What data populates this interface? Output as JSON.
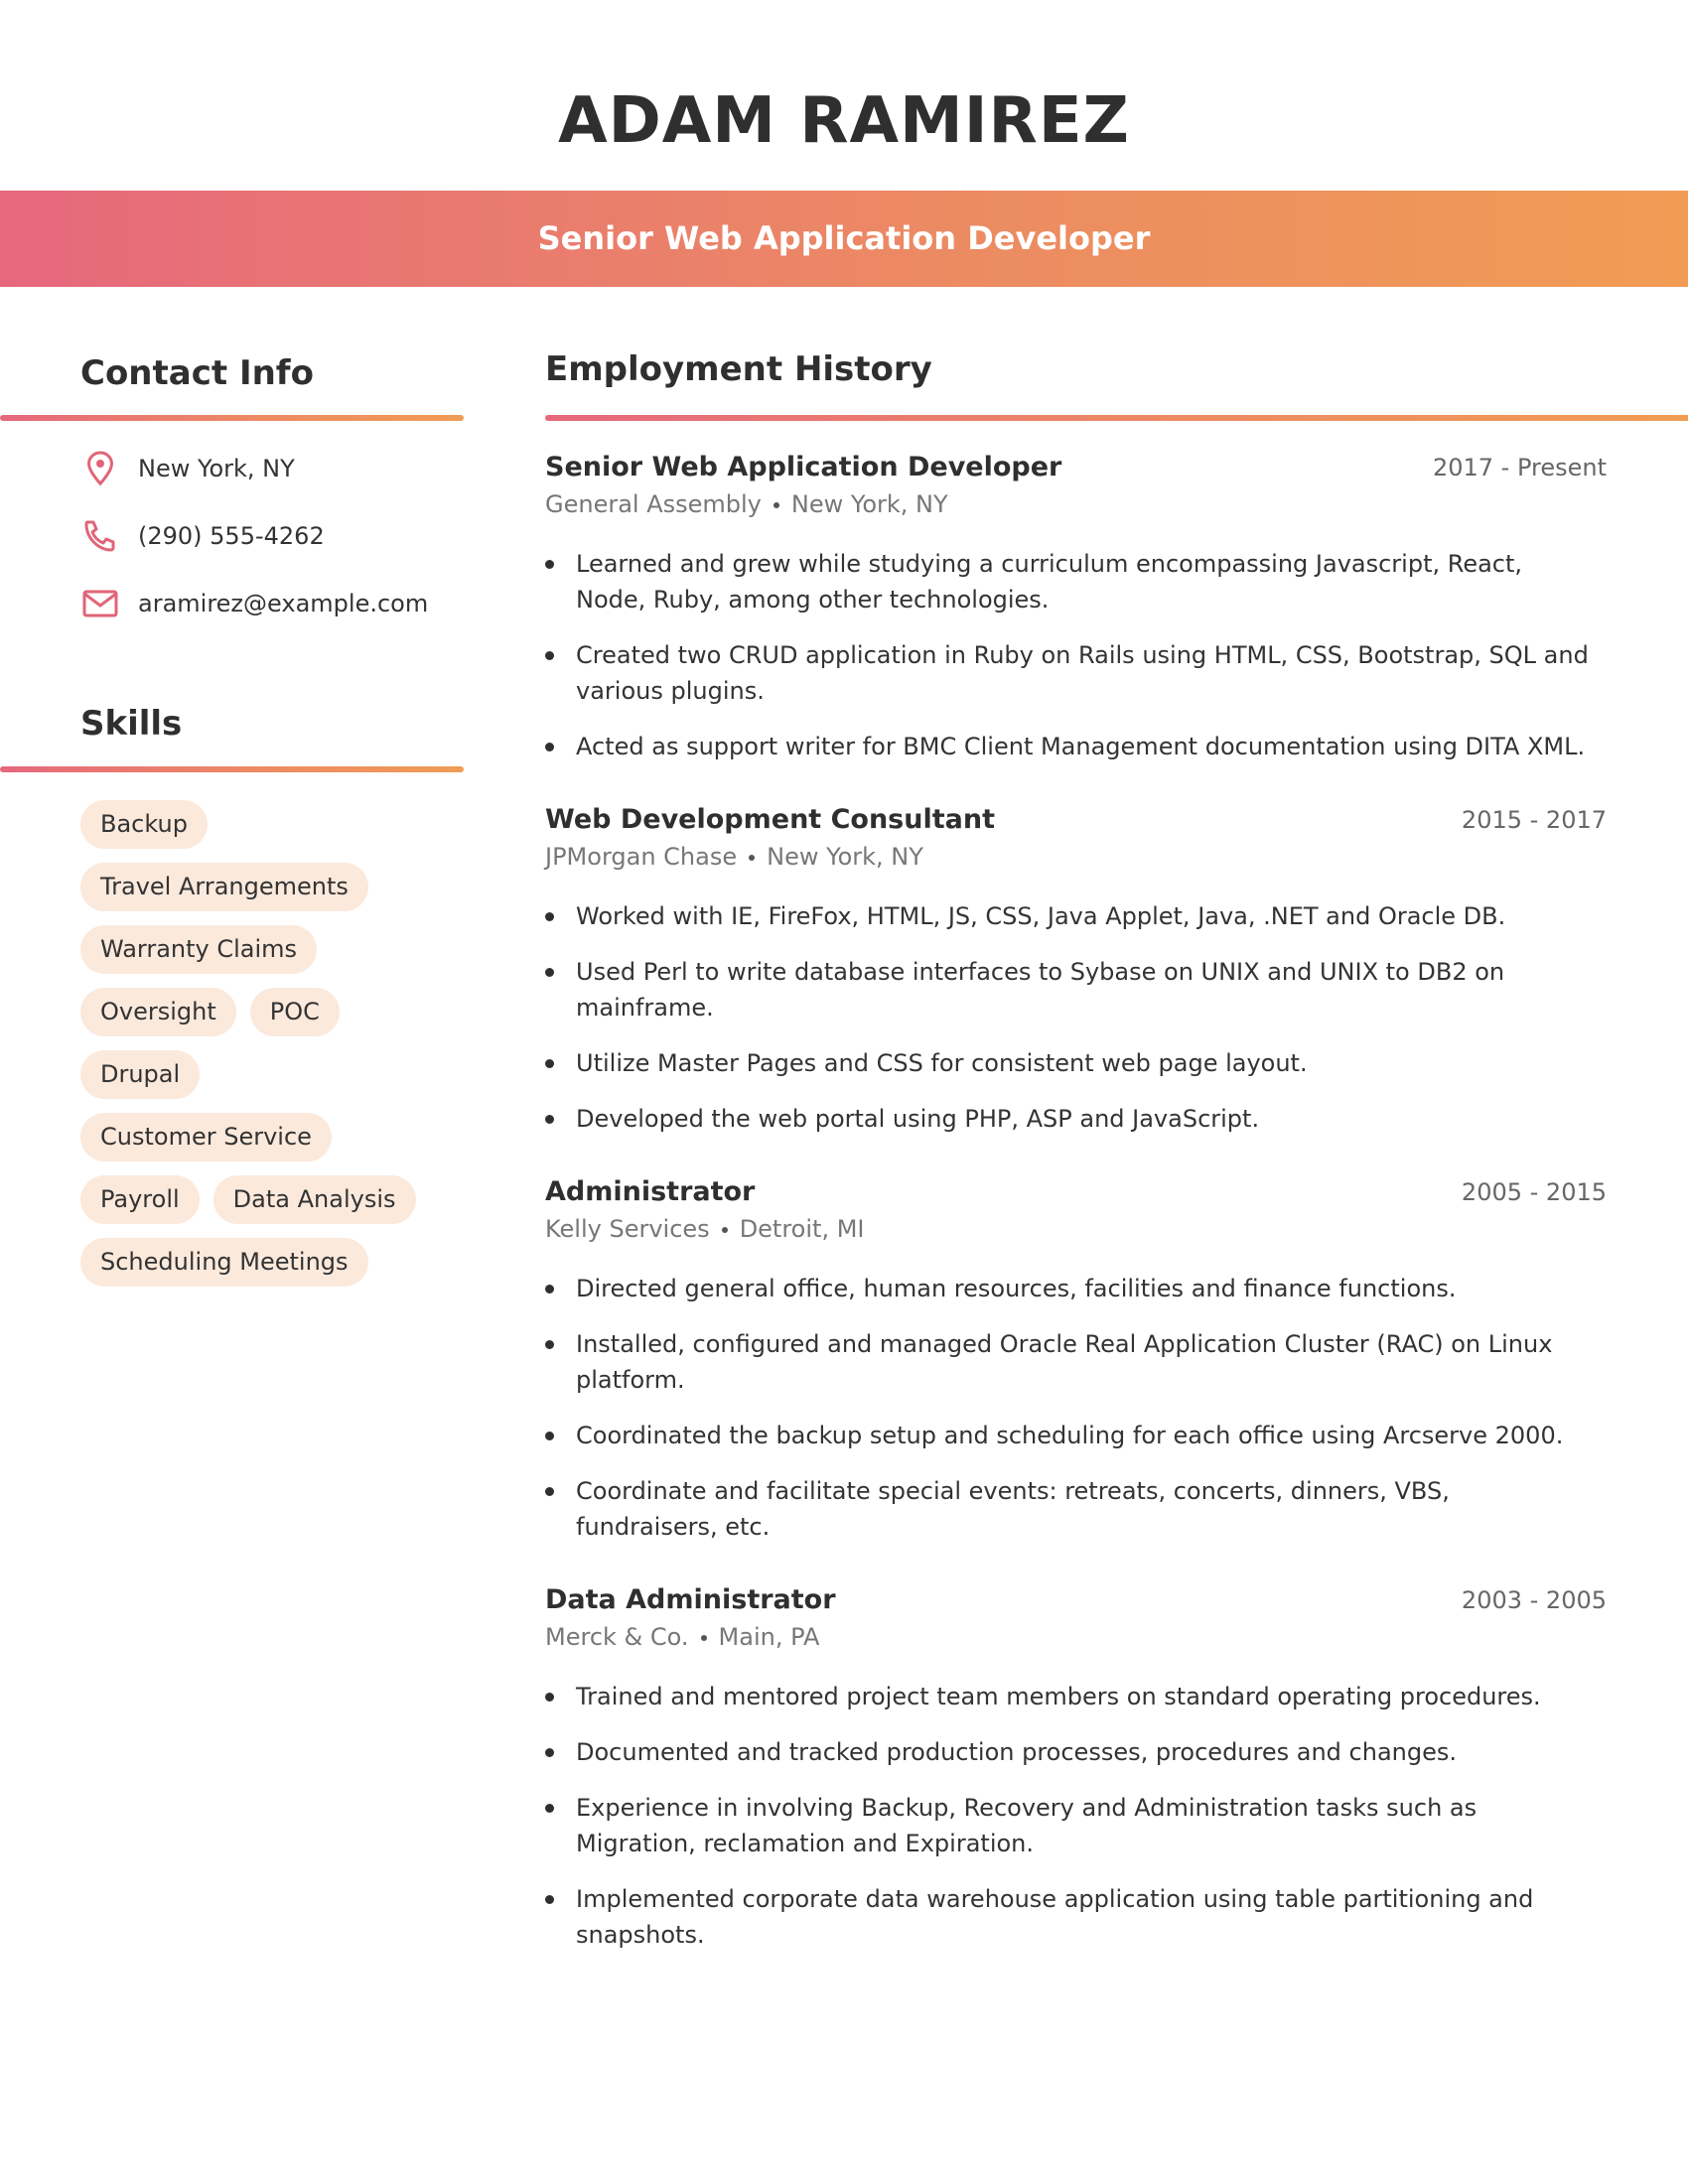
{
  "header": {
    "name": "ADAM RAMIREZ",
    "title": "Senior Web Application Developer"
  },
  "colors": {
    "accent_start": "#e6687d",
    "accent_end": "#f09c55",
    "skill_chip": "#fbe9dc",
    "icon": "#e06577"
  },
  "contact": {
    "heading": "Contact Info",
    "items": [
      {
        "icon": "location-pin-icon",
        "text": "New York, NY"
      },
      {
        "icon": "phone-icon",
        "text": "(290) 555-4262"
      },
      {
        "icon": "mail-icon",
        "text": "aramirez@example.com"
      }
    ]
  },
  "skills": {
    "heading": "Skills",
    "rows": [
      [
        "Backup"
      ],
      [
        "Travel Arrangements"
      ],
      [
        "Warranty Claims"
      ],
      [
        "Oversight",
        "POC"
      ],
      [
        "Drupal"
      ],
      [
        "Customer Service"
      ],
      [
        "Payroll",
        "Data Analysis"
      ],
      [
        "Scheduling Meetings"
      ]
    ]
  },
  "employment": {
    "heading": "Employment History",
    "jobs": [
      {
        "title": "Senior Web Application Developer",
        "dates": "2017 - Present",
        "company": "General Assembly",
        "location": "New York, NY",
        "bullets": [
          "Learned and grew while studying a curriculum encompassing Javascript, React, Node, Ruby, among other technologies.",
          "Created two CRUD application in Ruby on Rails using HTML, CSS, Bootstrap, SQL and various plugins.",
          "Acted as support writer for BMC Client Management documentation using DITA XML."
        ]
      },
      {
        "title": "Web Development Consultant",
        "dates": "2015 - 2017",
        "company": "JPMorgan Chase",
        "location": "New York, NY",
        "bullets": [
          "Worked with IE, FireFox, HTML, JS, CSS, Java Applet, Java, .NET and Oracle DB.",
          "Used Perl to write database interfaces to Sybase on UNIX and UNIX to DB2 on mainframe.",
          "Utilize Master Pages and CSS for consistent web page layout.",
          "Developed the web portal using PHP, ASP and JavaScript."
        ]
      },
      {
        "title": "Administrator",
        "dates": "2005 - 2015",
        "company": "Kelly Services",
        "location": "Detroit, MI",
        "bullets": [
          "Directed general office, human resources, facilities and finance functions.",
          "Installed, configured and managed Oracle Real Application Cluster (RAC) on Linux platform.",
          "Coordinated the backup setup and scheduling for each office using Arcserve 2000.",
          "Coordinate and facilitate special events: retreats, concerts, dinners, VBS, fundraisers, etc."
        ]
      },
      {
        "title": "Data Administrator",
        "dates": "2003 - 2005",
        "company": "Merck & Co.",
        "location": "Main, PA",
        "bullets": [
          "Trained and mentored project team members on standard operating procedures.",
          "Documented and tracked production processes, procedures and changes.",
          "Experience in involving Backup, Recovery and Administration tasks such as Migration, reclamation and Expiration.",
          "Implemented corporate data warehouse application using table partitioning and snapshots."
        ]
      }
    ]
  }
}
